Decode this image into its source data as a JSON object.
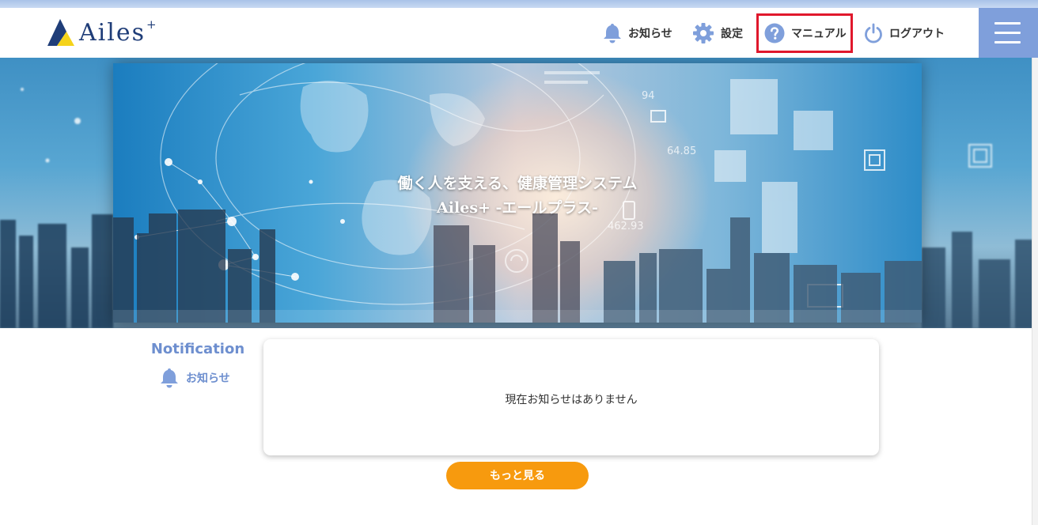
{
  "header": {
    "logo_text": "Ailes",
    "logo_sup": "+",
    "nav": {
      "news": "お知らせ",
      "settings": "設定",
      "manual": "マニュアル",
      "logout": "ログアウト"
    }
  },
  "hero": {
    "line1": "働く人を支える、健康管理システム",
    "line2": "Ailes+ -エールプラス-",
    "overlay_numbers": [
      "64.85",
      "462.93",
      "94"
    ]
  },
  "notification": {
    "heading": "Notification",
    "subheading": "お知らせ",
    "empty_message": "現在お知らせはありません",
    "more_button": "もっと見る"
  },
  "colors": {
    "accent": "#6e8fcf",
    "menu": "#7f9fdb",
    "button": "#f79a0e",
    "highlight": "#e0182c"
  }
}
